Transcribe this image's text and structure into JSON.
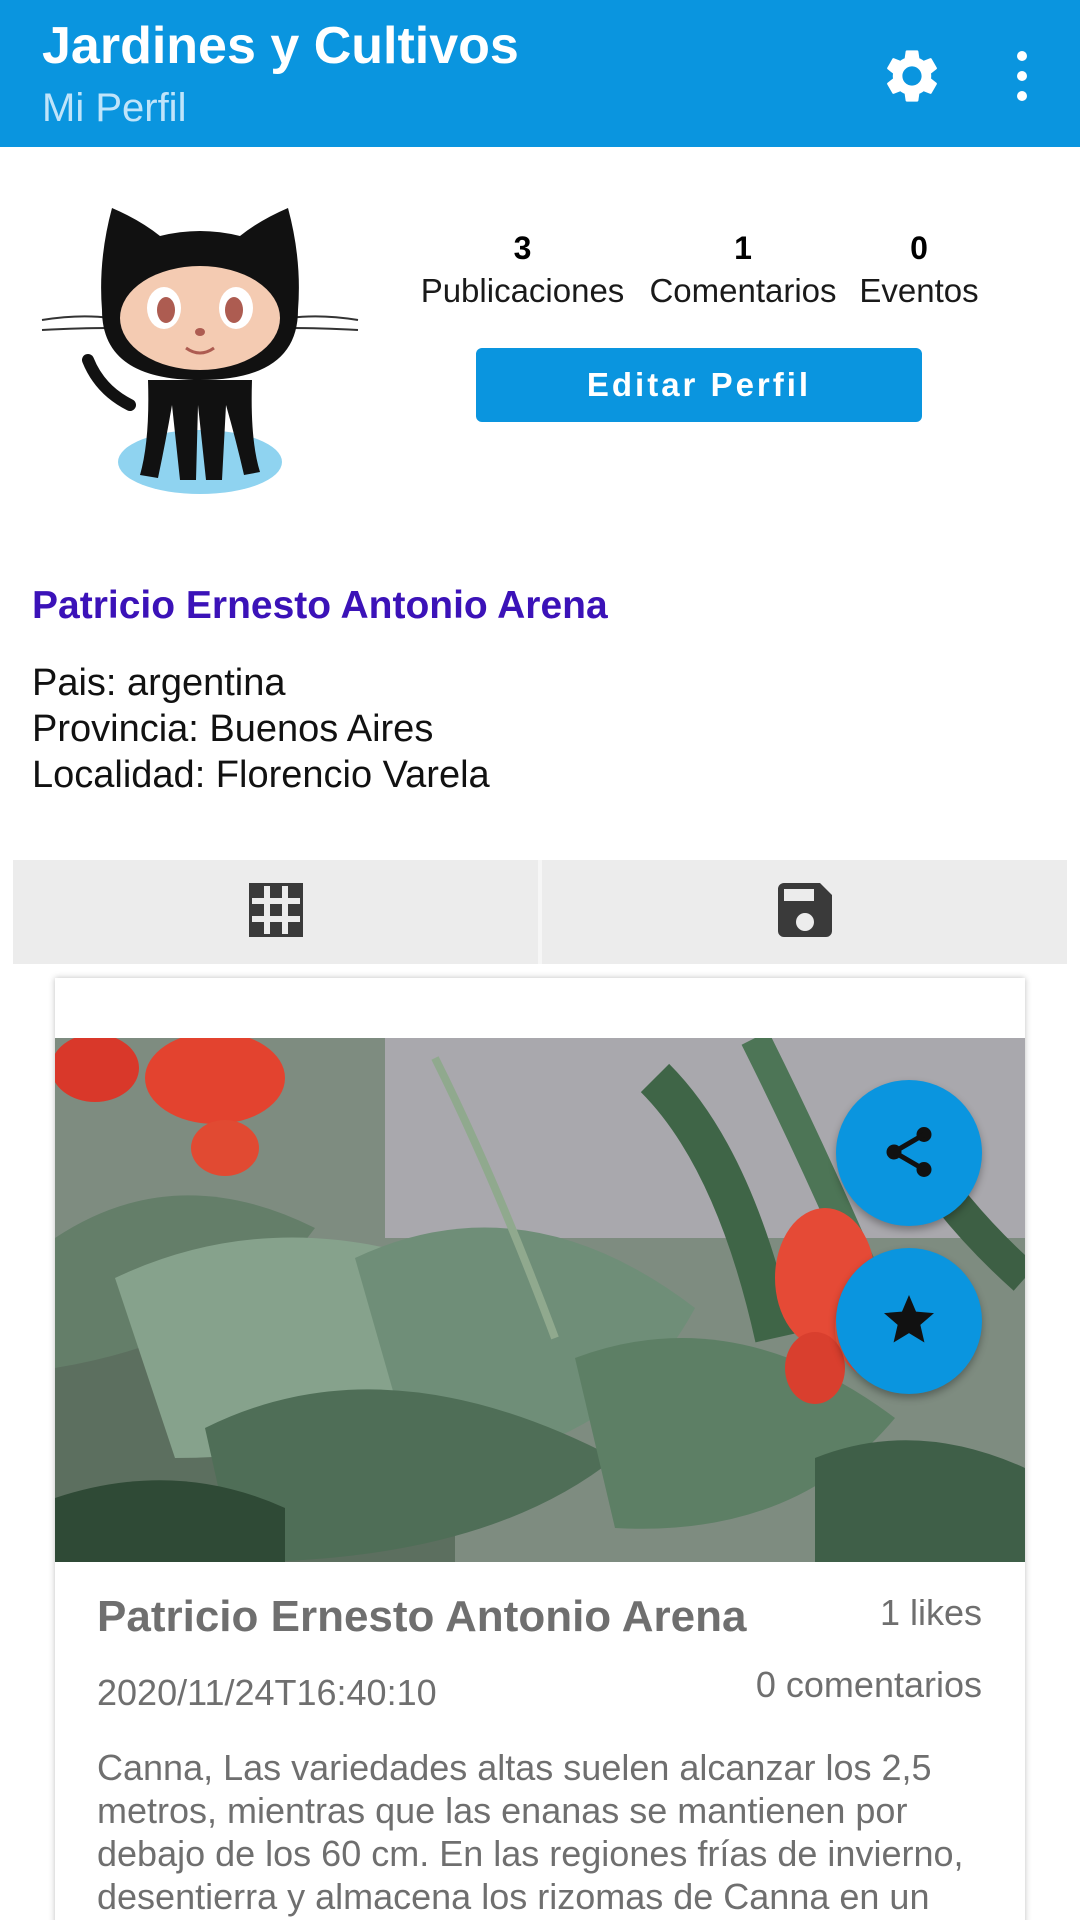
{
  "appbar": {
    "title": "Jardines y Cultivos",
    "subtitle": "Mi Perfil",
    "settings_icon": "gear-icon",
    "menu_icon": "more-vert-icon",
    "color": "#0a95df"
  },
  "profile": {
    "avatar": "octocat-avatar",
    "stats": [
      {
        "value": "3",
        "label": "Publicaciones"
      },
      {
        "value": "1",
        "label": "Comentarios"
      },
      {
        "value": "0",
        "label": "Eventos"
      }
    ],
    "edit_label": "Editar Perfil",
    "name": "Patricio Ernesto Antonio Arena",
    "name_color": "#3b12b8",
    "info": [
      "Pais: argentina",
      "Provincia: Buenos Aires",
      "Localidad: Florencio Varela"
    ]
  },
  "tabs": [
    {
      "icon": "grid-icon",
      "selected": true
    },
    {
      "icon": "save-icon",
      "selected": false
    }
  ],
  "post": {
    "image": "flower-photo",
    "share_icon": "share-icon",
    "favorite_icon": "star-icon",
    "author": "Patricio Ernesto Antonio Arena",
    "likes": "1 likes",
    "date": "2020/11/24T16:40:10",
    "comments": "0 comentarios",
    "text": "Canna, Las variedades altas suelen alcanzar los 2,5 metros, mientras que las enanas se mantienen por debajo de los 60 cm. En las regiones frías de invierno, desentierra y almacena los rizomas de Canna en un"
  }
}
